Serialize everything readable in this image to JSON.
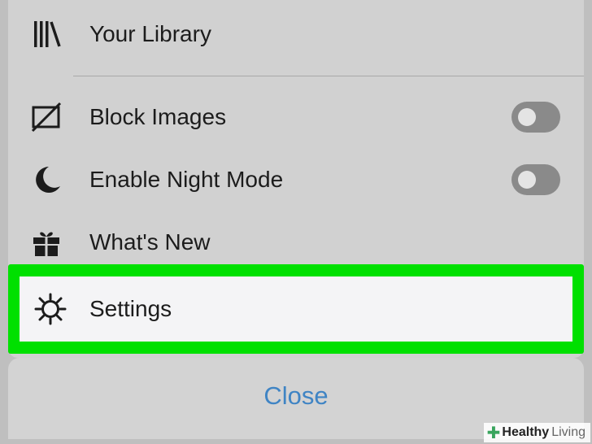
{
  "menu": {
    "items": [
      {
        "label": "Your Library",
        "icon": "library-icon"
      },
      {
        "label": "Block Images",
        "icon": "block-images-icon",
        "toggle": "off"
      },
      {
        "label": "Enable Night Mode",
        "icon": "moon-icon",
        "toggle": "off"
      },
      {
        "label": "What's New",
        "icon": "gift-icon"
      },
      {
        "label": "Settings",
        "icon": "gear-icon",
        "highlighted": true
      }
    ]
  },
  "close_label": "Close",
  "watermark": {
    "part1": "Healthy",
    "part2": "Living",
    "icon": "plus-cross-icon"
  },
  "colors": {
    "highlight": "#00e000",
    "close_text": "#3f84c4",
    "panel": "#d1d1d1"
  }
}
